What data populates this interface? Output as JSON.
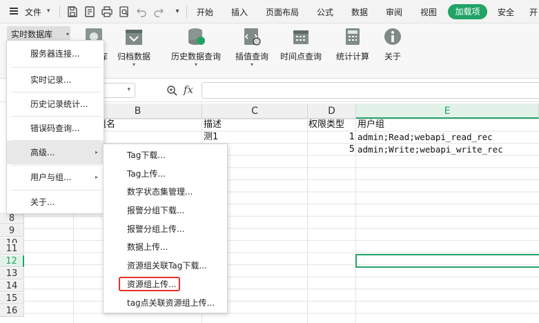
{
  "menubar": {
    "file_label": "文件",
    "items": [
      "开始",
      "插入",
      "页面布局",
      "公式",
      "数据",
      "审阅",
      "视图"
    ],
    "active_item": "加载项",
    "trailing_items": [
      "安全",
      "开"
    ]
  },
  "ribbon": {
    "realtime_db_label": "实时数据库",
    "buttons": {
      "archive": "归档数据",
      "history_query": "历史数据查询",
      "interp_query": "插值查询",
      "timepoint_query": "时间点查询",
      "stat_calc": "统计计算",
      "about": "关于"
    },
    "partial_label": "库"
  },
  "grid": {
    "columns": [
      "B",
      "C",
      "D",
      "E"
    ],
    "rows": [
      "8",
      "9",
      "10",
      "11",
      "12",
      "13",
      "14",
      "15",
      "16"
    ],
    "header_row": {
      "b_partial": "组名",
      "c": "描述",
      "d": "权限类型",
      "e": "用户组"
    },
    "row_a": {
      "c": "测1",
      "d": "1",
      "e": "admin;Read;webapi_read_rec"
    },
    "row_b": {
      "d": "5",
      "e": "admin;Write;webapi_write_rec"
    }
  },
  "dropdown_main": {
    "items": [
      "服务器连接...",
      "实时记录...",
      "历史记录统计...",
      "错误码查询...",
      "高级...",
      "用户与组...",
      "关于..."
    ]
  },
  "dropdown_sub": {
    "items": [
      "Tag下载...",
      "Tag上传...",
      "数字状态集管理...",
      "报警分组下载...",
      "报警分组上传...",
      "数据上传...",
      "资源组关联Tag下载...",
      "资源组上传...",
      "tag点关联资源组上传..."
    ]
  },
  "colors": {
    "accent": "#21a366",
    "highlight_box": "#e8302a"
  }
}
